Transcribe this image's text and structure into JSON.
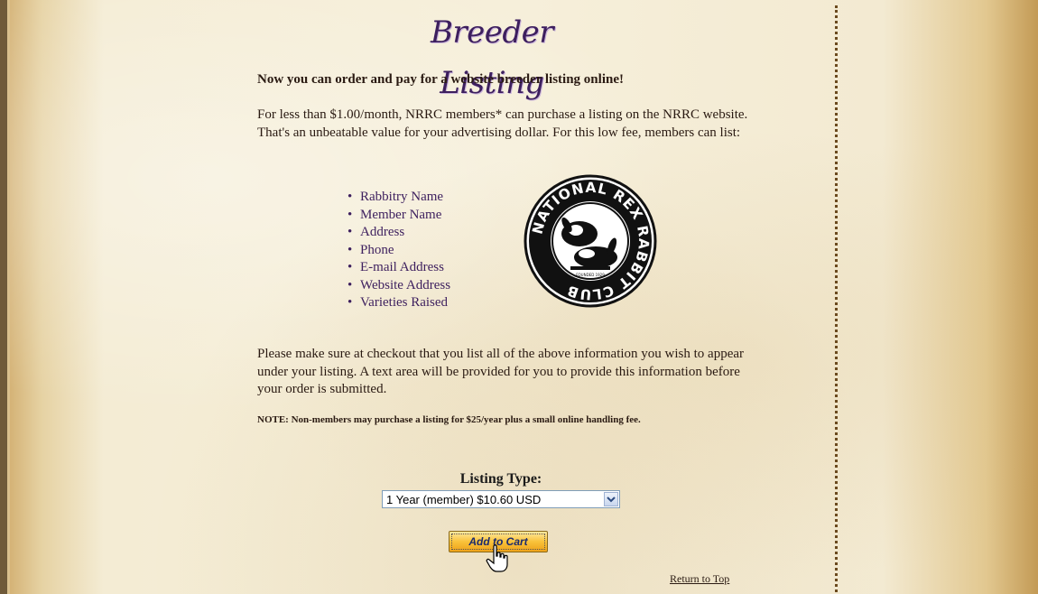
{
  "page": {
    "title": "Breeder Listing",
    "headline": "Now you can order and pay for a website breeder listing online!",
    "intro": "For less than $1.00/month, NRRC members* can purchase a listing on the NRRC website. That's an unbeatable value for your advertising dollar. For this low fee, members can list:",
    "list_items": [
      "Rabbitry Name",
      "Member Name",
      "Address",
      "Phone",
      "E-mail Address",
      "Website Address",
      "Varieties Raised"
    ],
    "checkout_note": "Please make sure at checkout that you list all of the above information you wish to appear under your listing. A text area will be provided for you to provide this information before your order is submitted.",
    "nonmember_note": "NOTE: Non-members may purchase a listing for $25/year plus a small online handling fee."
  },
  "logo": {
    "text_top": "NATIONAL REX RABBIT CLUB",
    "founded": "FOUNDED 1929"
  },
  "form": {
    "label": "Listing Type:",
    "selected": "1 Year (member) $10.60 USD",
    "add_to_cart": "Add to Cart"
  },
  "footer": {
    "return_top": "Return to Top"
  },
  "colors": {
    "title": "#3d1f5e",
    "text": "#2a1a12",
    "list": "#3d1f5e",
    "button": "#f9c23a",
    "divider": "#6b4a1e"
  }
}
